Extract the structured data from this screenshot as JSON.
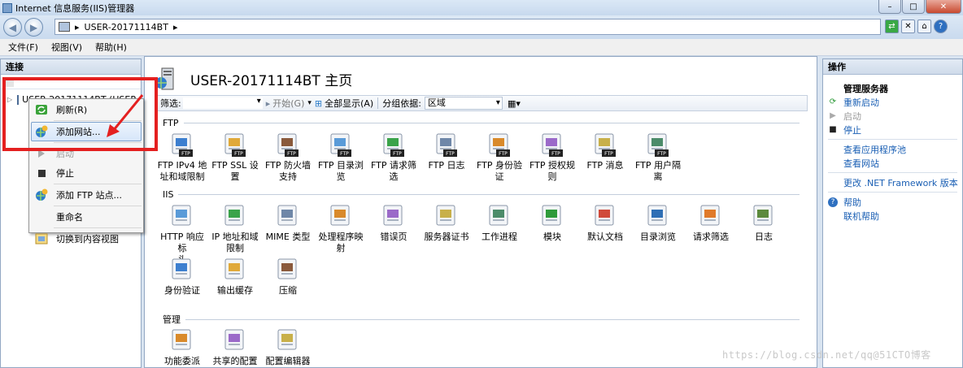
{
  "window": {
    "title": "Internet 信息服务(IIS)管理器",
    "buttons": {
      "minimize": "–",
      "maximize": "□",
      "close": "✕"
    }
  },
  "address": {
    "sep1": "▸",
    "server": "USER-20171114BT",
    "sep2": "▸"
  },
  "menu": [
    "文件(F)",
    "视图(V)",
    "帮助(H)"
  ],
  "connections": {
    "header": "连接",
    "node": "USER-20171114BT (USER-2"
  },
  "context_menu": [
    {
      "label": "刷新(R)",
      "icon": "refresh-icon"
    },
    {
      "label": "添加网站...",
      "icon": "globe-add-icon",
      "highlighted": true
    },
    {
      "label": "启动",
      "icon": "start-icon",
      "disabled": true
    },
    {
      "label": "停止",
      "icon": "stop-icon"
    },
    {
      "label": "添加 FTP 站点...",
      "icon": "ftp-add-icon"
    },
    {
      "label": "重命名",
      "icon": ""
    },
    {
      "label": "切换到内容视图",
      "icon": "content-view-icon"
    }
  ],
  "main": {
    "title": "USER-20171114BT 主页",
    "filter": {
      "label": "筛选:",
      "start": "开始(G)",
      "show_all": "全部显示(A)",
      "group_by": "分组依据:",
      "group_value": "区域"
    },
    "sections": [
      {
        "name": "FTP",
        "items": [
          [
            "FTP IPv4 地",
            "址和域限制"
          ],
          [
            "FTP SSL 设",
            "置"
          ],
          [
            "FTP 防火墙",
            "支持"
          ],
          [
            "FTP 目录浏",
            "览"
          ],
          [
            "FTP 请求筛",
            "选"
          ],
          [
            "FTP 日志",
            ""
          ],
          [
            "FTP 身份验",
            "证"
          ],
          [
            "FTP 授权规",
            "则"
          ],
          [
            "FTP 消息",
            ""
          ],
          [
            "FTP 用户隔",
            "离"
          ]
        ]
      },
      {
        "name": "IIS",
        "items": [
          [
            "HTTP 响应标",
            "头"
          ],
          [
            "IP 地址和域",
            "限制"
          ],
          [
            "MIME 类型",
            ""
          ],
          [
            "处理程序映",
            "射"
          ],
          [
            "错误页",
            ""
          ],
          [
            "服务器证书",
            ""
          ],
          [
            "工作进程",
            ""
          ],
          [
            "模块",
            ""
          ],
          [
            "默认文档",
            ""
          ],
          [
            "目录浏览",
            ""
          ],
          [
            "请求筛选",
            ""
          ],
          [
            "日志",
            ""
          ],
          [
            "身份验证",
            ""
          ],
          [
            "输出缓存",
            ""
          ],
          [
            "压缩",
            ""
          ]
        ]
      },
      {
        "name": "管理",
        "items": [
          [
            "功能委派",
            ""
          ],
          [
            "共享的配置",
            ""
          ],
          [
            "配置编辑器",
            ""
          ]
        ]
      }
    ]
  },
  "actions": {
    "header": "操作",
    "group": "管理服务器",
    "items": [
      {
        "label": "重新启动",
        "icon": "restart-icon",
        "type": "link"
      },
      {
        "label": "启动",
        "icon": "start-icon",
        "type": "dis"
      },
      {
        "label": "停止",
        "icon": "stop-icon",
        "type": "link"
      },
      {
        "label": "查看应用程序池",
        "icon": "",
        "type": "link"
      },
      {
        "label": "查看网站",
        "icon": "",
        "type": "link"
      },
      {
        "label": "更改 .NET Framework 版本",
        "icon": "",
        "type": "link"
      },
      {
        "label": "帮助",
        "icon": "help-icon",
        "type": "link"
      },
      {
        "label": "联机帮助",
        "icon": "",
        "type": "link"
      }
    ]
  },
  "watermark": "https://blog.csdn.net/qq@51CTO博客",
  "colors": {
    "accent": "#1a5fb4",
    "highlight_box": "#e42020"
  }
}
